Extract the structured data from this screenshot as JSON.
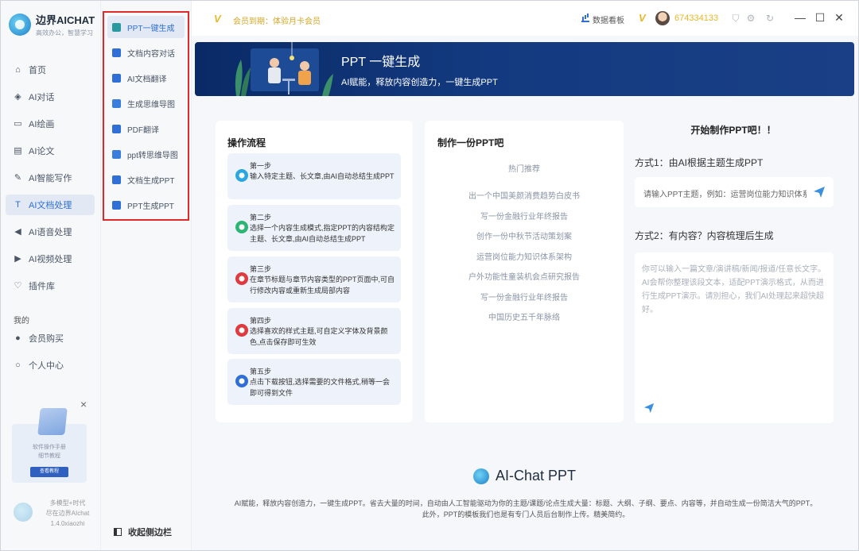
{
  "app": {
    "title": "边界AICHAT",
    "subtitle": "高效办公，智慧学习"
  },
  "sidebar": {
    "items": [
      {
        "label": "首页",
        "icon": "home-icon",
        "glyph": "⌂"
      },
      {
        "label": "AI对话",
        "icon": "cube-icon",
        "glyph": "◈"
      },
      {
        "label": "AI绘画",
        "icon": "image-icon",
        "glyph": "▭"
      },
      {
        "label": "AI论文",
        "icon": "document-icon",
        "glyph": "▤"
      },
      {
        "label": "AI智能写作",
        "icon": "pen-icon",
        "glyph": "✎"
      },
      {
        "label": "AI文档处理",
        "icon": "text-doc-icon",
        "glyph": "T"
      },
      {
        "label": "AI语音处理",
        "icon": "speaker-icon",
        "glyph": "◀"
      },
      {
        "label": "AI视频处理",
        "icon": "video-icon",
        "glyph": "▶"
      },
      {
        "label": "插件库",
        "icon": "lightbulb-icon",
        "glyph": "♡"
      }
    ],
    "section_mine": "我的",
    "mine_items": [
      {
        "label": "会员购买",
        "icon": "member-icon",
        "glyph": "●"
      },
      {
        "label": "个人中心",
        "icon": "user-icon",
        "glyph": "○"
      }
    ],
    "promo": {
      "close": "×",
      "text": "软件操作手册\n细节教程",
      "button": "查看教程"
    },
    "footer": "多模型+时代\n尽在边界AIchat\n1.4.0xiaozhi"
  },
  "sub_sidebar": {
    "items": [
      {
        "label": "PPT一键生成",
        "color": "#2b9aa0"
      },
      {
        "label": "文档内容对话",
        "color": "#2f6fd6"
      },
      {
        "label": "AI文档翻译",
        "color": "#2f6fd6"
      },
      {
        "label": "生成思维导图",
        "color": "#3b7ddd"
      },
      {
        "label": "PDF翻译",
        "color": "#2f6fd6"
      },
      {
        "label": "ppt转思维导图",
        "color": "#3b7ddd"
      },
      {
        "label": "文档生成PPT",
        "color": "#2f6fd6"
      },
      {
        "label": "PPT生成PPT",
        "color": "#2f6fd6"
      }
    ],
    "collapse_label": "收起侧边栏"
  },
  "topbar": {
    "vip_logo": "V",
    "vip_text": "会员到期：体验月卡会员",
    "dashboard": "数据看板",
    "badge": "V",
    "user_id": "674334133",
    "icons": [
      "shirt-icon",
      "settings-icon",
      "refresh-icon"
    ],
    "controls": {
      "minimize": "—",
      "maximize": "☐",
      "close": "✕"
    }
  },
  "banner": {
    "title": "PPT 一键生成",
    "subtitle": "AI赋能，释放内容创造力，一键生成PPT"
  },
  "workflow": {
    "title": "操作流程",
    "steps": [
      {
        "title": "第一步",
        "desc": "输入特定主题、长文章,由AI自动总结生成PPT",
        "icon_color": "#2aa7e0"
      },
      {
        "title": "第二步",
        "desc": "选择一个内容生成模式,指定PPT的内容结构定主题、长文章,由AI自动总结生成PPT",
        "icon_color": "#2bb673"
      },
      {
        "title": "第三步",
        "desc": "在章节标题与章节内容类型的PPT页面中,可自行修改内容或重新生成局部内容",
        "icon_color": "#e0393e"
      },
      {
        "title": "第四步",
        "desc": "选择喜欢的样式主题,可自定义字体及背景颜色,点击保存即可生效",
        "icon_color": "#e0393e"
      },
      {
        "title": "第五步",
        "desc": "点击下载按钮,选择需要的文件格式,稍等一会即可得到文件",
        "icon_color": "#2f6fd6"
      }
    ]
  },
  "make_ppt": {
    "title": "制作一份PPT吧",
    "hot_label": "热门推荐",
    "items": [
      "出一个中国美颜消费趋势白皮书",
      "写一份金融行业年终报告",
      "创作一份中秋节活动策划案",
      "运营岗位能力知识体系架构",
      "户外功能性童装机会点研究报告",
      "写一份金融行业年终报告",
      "中国历史五千年脉络"
    ]
  },
  "start": {
    "heading": "开始制作PPT吧！！",
    "mode1": "方式1：由AI根据主题生成PPT",
    "input_placeholder": "请输入PPT主题，例如：运营岗位能力知识体系架构",
    "mode2": "方式2：有内容？内容梳理后生成",
    "textarea_placeholder": "你可以输入一篇文章/演讲稿/新闻/报道/任意长文字。AI会帮你整理该段文本，适配PPT演示格式，从而进行生成PPT演示。请別担心，我们AI处理起来超快超好。"
  },
  "footer": {
    "brand": "AI-Chat PPT",
    "desc": "AI赋能，释放内容创造力，一键生成PPT。省去大量的时间，自动由人工智能驱动为你的主题/课题/论点生成大量：标题、大纲、子纲、要点、内容等，并自动生成一份简洁大气的PPT。此外，PPT的模板我们也是有专门人员后台制作上传。精美简约。"
  },
  "colors": {
    "accent": "#2f6fd6",
    "highlight_box": "#e02a2a",
    "banner": "#0a2a66",
    "vip_gold": "#e8b82a"
  }
}
